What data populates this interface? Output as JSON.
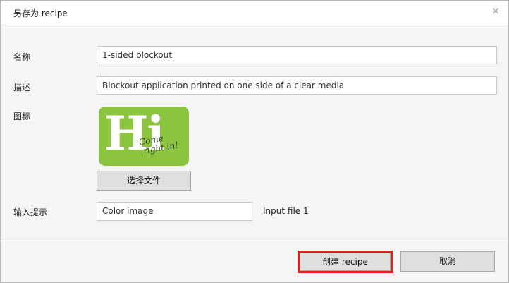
{
  "dialog": {
    "title": "另存为 recipe",
    "close_glyph": "×"
  },
  "form": {
    "name_label": "名称",
    "name_value": "1-sided blockout",
    "description_label": "描述",
    "description_value": "Blockout application printed on one side of a clear media",
    "icon_label": "图标",
    "icon_image": {
      "big_text": "Hi",
      "script_line1": "Come",
      "script_line2": "right in!"
    },
    "choose_file_label": "选择文件",
    "input_hint_label": "输入提示",
    "input_hint_value": "Color image",
    "input_file_text": "Input file 1"
  },
  "footer": {
    "create_label": "创建 recipe",
    "cancel_label": "取消"
  },
  "colors": {
    "highlight": "#e02020",
    "icon_background": "#8bc53f"
  }
}
